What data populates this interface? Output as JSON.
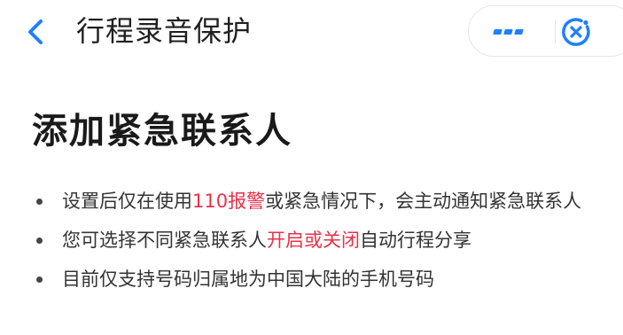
{
  "header": {
    "title": "行程录音保护",
    "back_icon": "chevron-left-icon",
    "more_icon": "more-dots-icon",
    "close_icon": "close-circle-icon",
    "accent_color": "#1e80ff"
  },
  "main": {
    "heading": "添加紧急联系人",
    "items": [
      {
        "before": "设置后仅在使用",
        "highlight": "110报警",
        "after": "或紧急情况下，会主动通知紧急联系人"
      },
      {
        "before": "您可选择不同紧急联系人",
        "highlight": "开启或关闭",
        "after": "自动行程分享"
      },
      {
        "before": "目前仅支持号码归属地为中国大陆的手机号码",
        "highlight": "",
        "after": ""
      }
    ],
    "highlight_color": "#e8324a"
  }
}
